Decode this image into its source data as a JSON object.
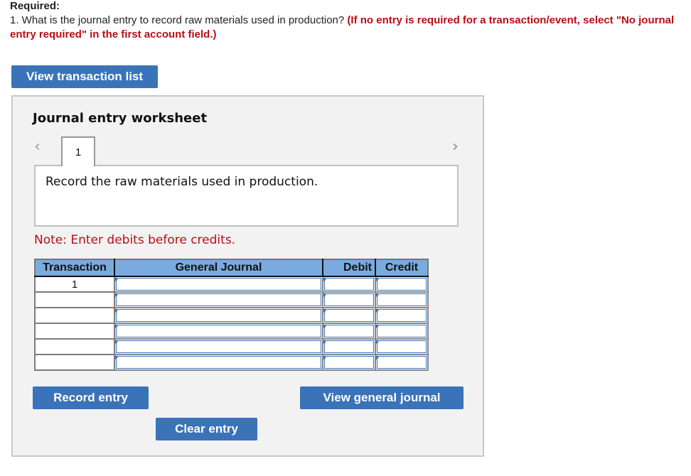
{
  "header": {
    "required_label": "Required:",
    "question_text": "1. What is the journal entry to record raw materials used in production? ",
    "question_instruction": "(If no entry is required for a transaction/event, select \"No journal entry required\" in the first account field.)"
  },
  "buttons": {
    "view_transaction_list": "View transaction list",
    "record_entry": "Record entry",
    "clear_entry": "Clear entry",
    "view_general_journal": "View general journal"
  },
  "worksheet": {
    "title": "Journal entry worksheet",
    "prev_icon": "‹",
    "next_icon": "›",
    "active_tab": "1",
    "description": "Record the raw materials used in production.",
    "note": "Note: Enter debits before credits."
  },
  "journal": {
    "columns": [
      "Transaction",
      "General Journal",
      "Debit",
      "Credit"
    ],
    "rows": [
      {
        "transaction": "1",
        "account": "",
        "debit": "",
        "credit": ""
      },
      {
        "transaction": "",
        "account": "",
        "debit": "",
        "credit": ""
      },
      {
        "transaction": "",
        "account": "",
        "debit": "",
        "credit": ""
      },
      {
        "transaction": "",
        "account": "",
        "debit": "",
        "credit": ""
      },
      {
        "transaction": "",
        "account": "",
        "debit": "",
        "credit": ""
      },
      {
        "transaction": "",
        "account": "",
        "debit": "",
        "credit": ""
      }
    ]
  },
  "colors": {
    "button_bg": "#3a73b8",
    "instruction_red": "#b50f16",
    "header_blue": "#79abe0"
  }
}
